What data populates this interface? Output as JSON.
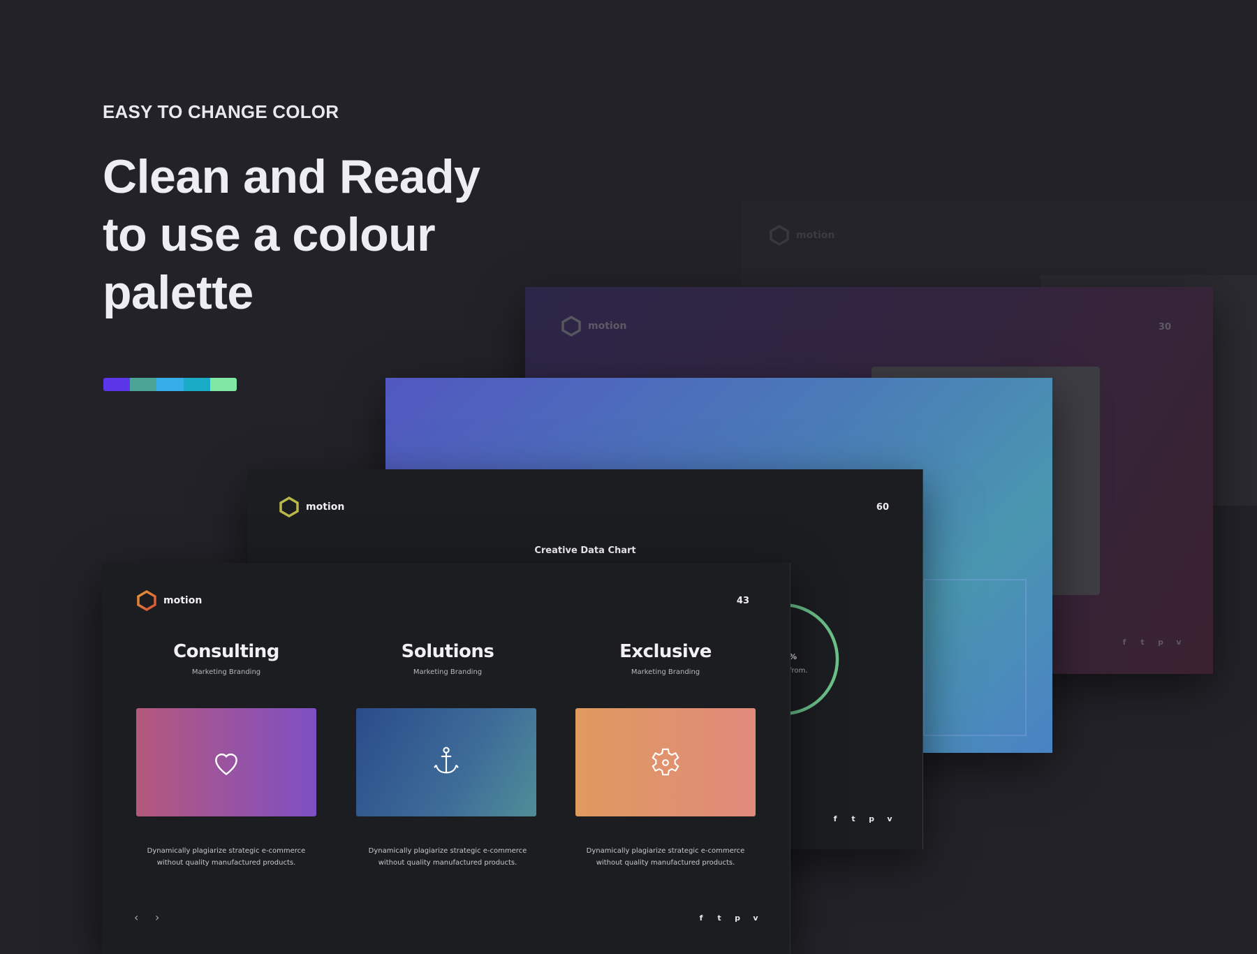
{
  "hero": {
    "eyebrow": "EASY TO CHANGE COLOR",
    "title_lines": [
      "Clean and Ready",
      "to use a colour",
      "palette"
    ],
    "palette": [
      "#5b35e8",
      "#4aa596",
      "#36aee8",
      "#1aacc6",
      "#80e8a2"
    ]
  },
  "slides": {
    "faint": {
      "brand": "motion"
    },
    "purple": {
      "brand": "motion",
      "page": "30"
    },
    "chart": {
      "brand": "motion",
      "page": "60",
      "heading": "Creative Data Chart",
      "ring_percent_suffix": "%",
      "ring_caption": "l from.",
      "ring_color": "#6cc08a"
    },
    "front": {
      "brand": "motion",
      "page": "43",
      "logo_color": "#e0673a",
      "columns": [
        {
          "title": "Consulting",
          "subtitle": "Marketing Branding",
          "icon": "heart-icon",
          "desc_lines": [
            "Dynamically plagiarize strategic e-commerce",
            "without quality manufactured products."
          ]
        },
        {
          "title": "Solutions",
          "subtitle": "Marketing Branding",
          "icon": "anchor-icon",
          "desc_lines": [
            "Dynamically plagiarize strategic e-commerce",
            "without quality manufactured products."
          ]
        },
        {
          "title": "Exclusive",
          "subtitle": "Marketing Branding",
          "icon": "gear-icon",
          "desc_lines": [
            "Dynamically plagiarize strategic e-commerce",
            "without quality manufactured products."
          ]
        }
      ]
    },
    "social": [
      "f",
      "t",
      "p",
      "v"
    ]
  }
}
